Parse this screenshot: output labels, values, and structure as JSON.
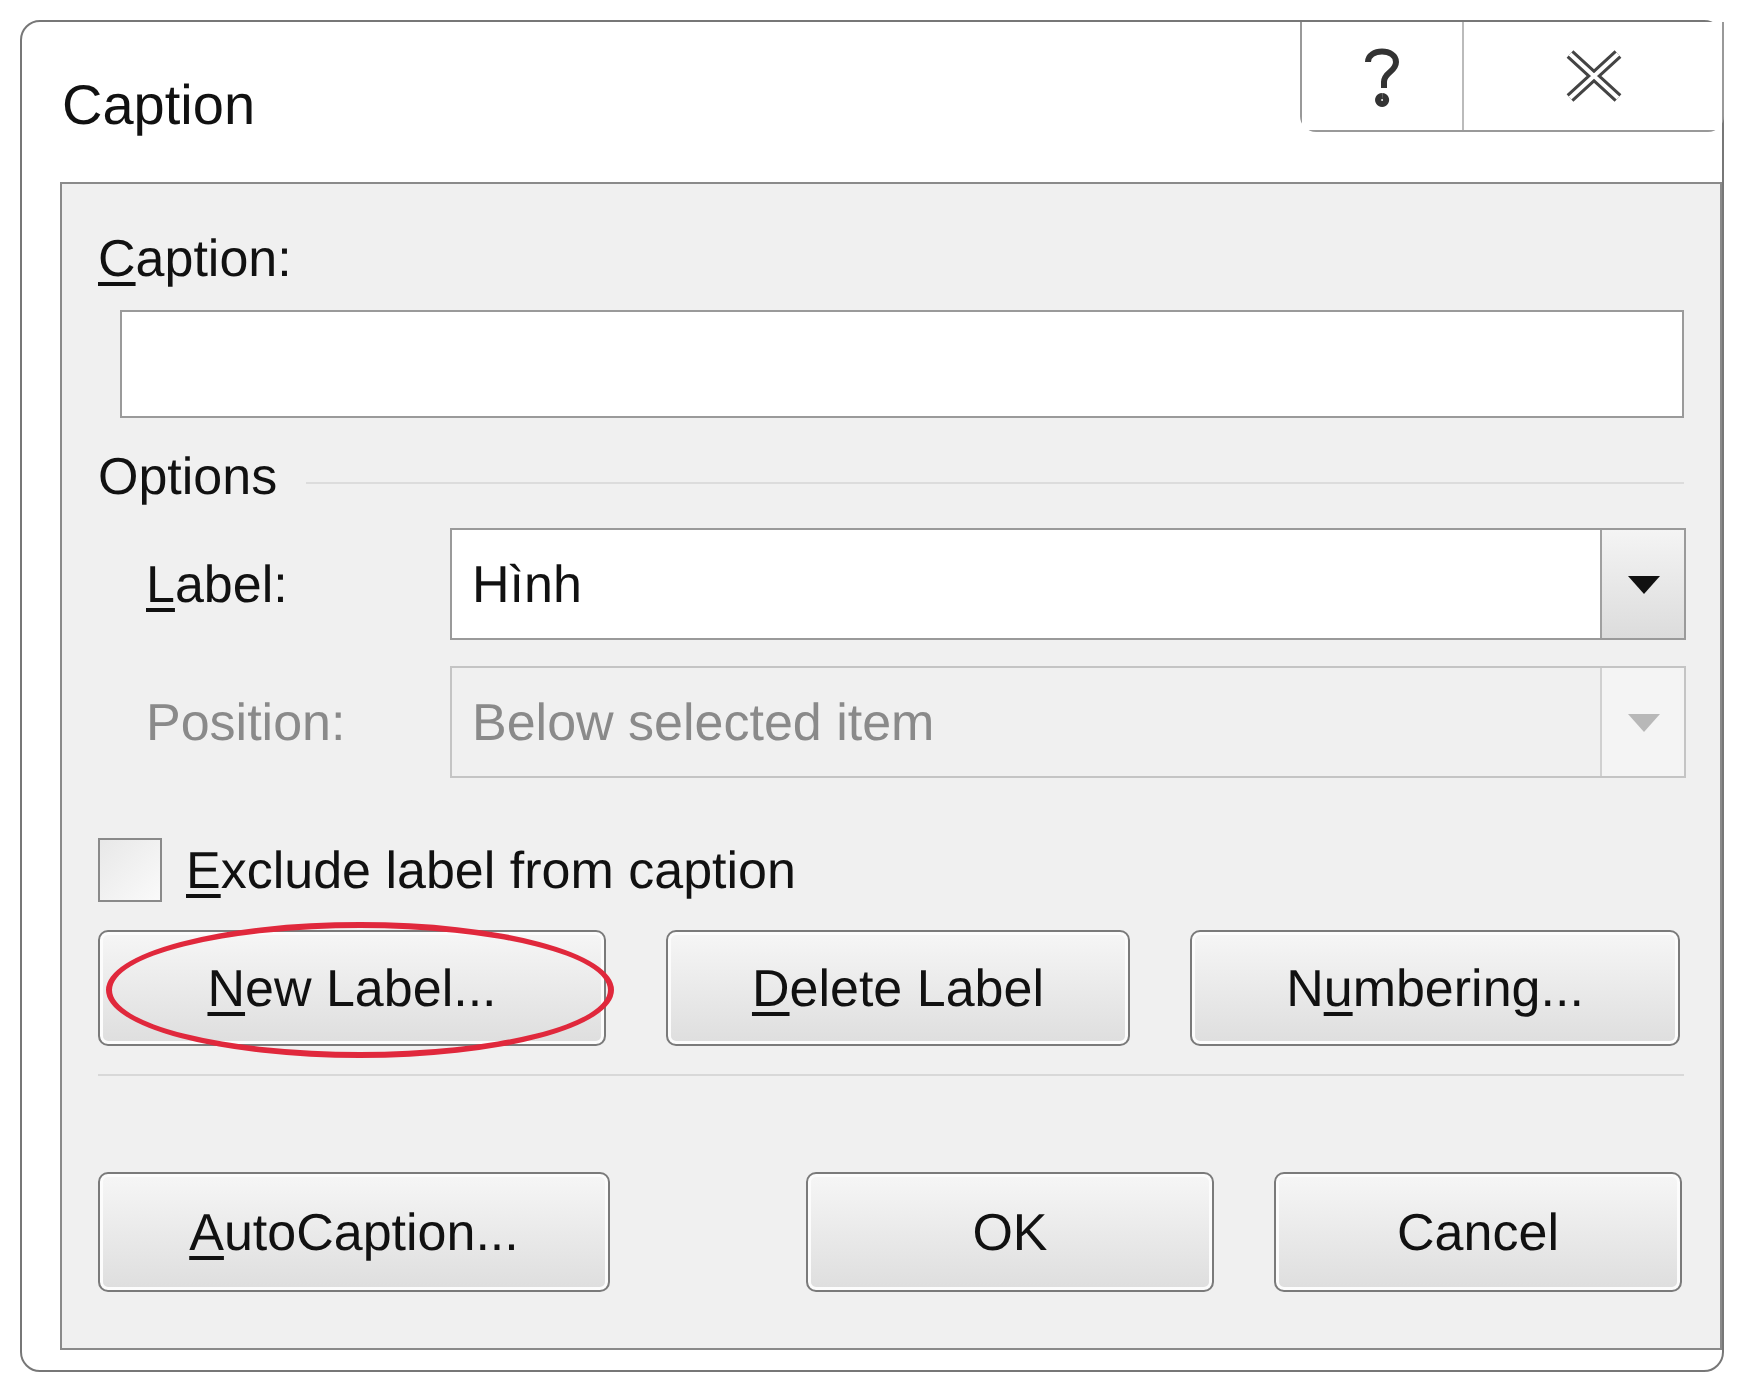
{
  "window": {
    "title": "Caption"
  },
  "caption_field": {
    "label": {
      "key": "C",
      "after": "aption:"
    }
  },
  "options": {
    "heading": "Options",
    "label_combo": {
      "label": {
        "key": "L",
        "after": "abel:"
      },
      "value": "Hình",
      "disabled": false
    },
    "position_combo": {
      "label": {
        "before": "Position:"
      },
      "value": "Below selected item",
      "disabled": true
    },
    "exclude_checkbox": {
      "label": {
        "key": "E",
        "after": "xclude label from caption"
      },
      "checked": false
    },
    "label_buttons": [
      {
        "label": {
          "key": "N",
          "after": "ew Label..."
        },
        "circled": true
      },
      {
        "label": {
          "key": "D",
          "after": "elete Label"
        },
        "circled": false
      },
      {
        "label": {
          "before": "N",
          "key": "u",
          "after": "mbering..."
        },
        "circled": false
      }
    ]
  },
  "footer_buttons": [
    {
      "label": {
        "key": "A",
        "after": "utoCaption..."
      }
    },
    {
      "label": {
        "before": "OK"
      }
    },
    {
      "label": {
        "before": "Cancel"
      }
    }
  ]
}
